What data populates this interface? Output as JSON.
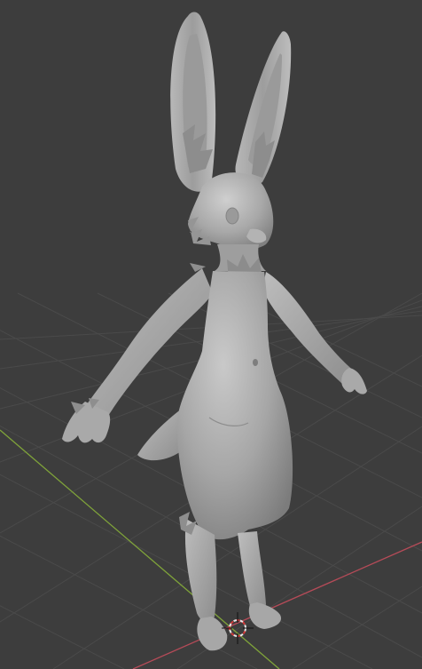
{
  "viewport": {
    "background_color": "#3d3d3d",
    "grid_line_color": "#4a4a4a",
    "x_axis_color": "#b54b58",
    "y_axis_color": "#7fa33a",
    "cursor_color_red": "#d43a3a",
    "cursor_color_white": "#e8e8e8",
    "model_color": "#a9a9a9",
    "icons": [
      "3d-cursor-icon"
    ],
    "object": "rabbit-character-model"
  }
}
